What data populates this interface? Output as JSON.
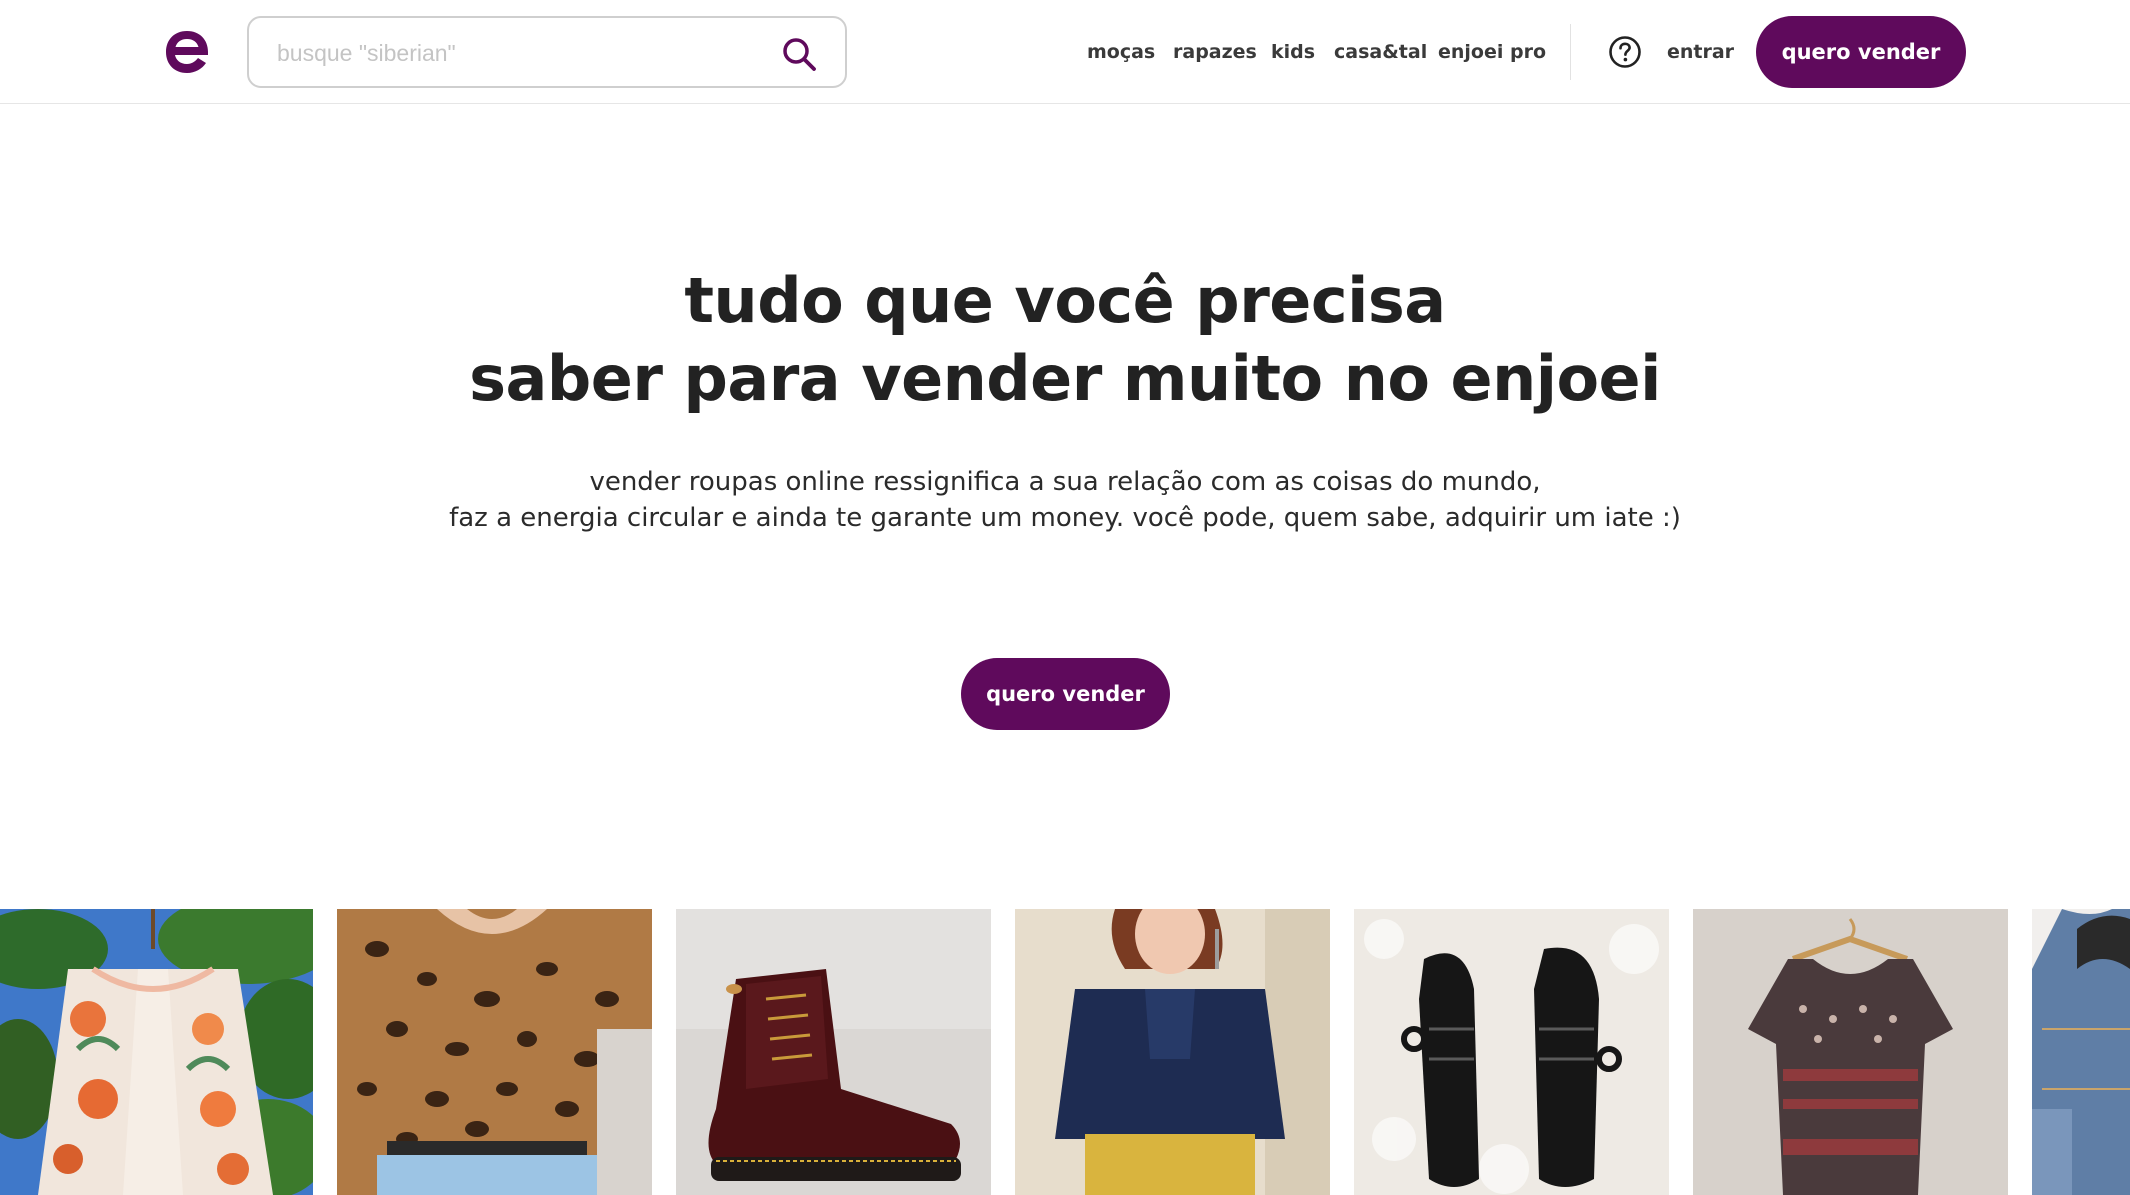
{
  "header": {
    "logo_icon": "enjoei-e-logo",
    "search": {
      "placeholder": "busque \"siberian\"",
      "value": "",
      "icon": "search-icon"
    },
    "nav": [
      {
        "label": "moças"
      },
      {
        "label": "rapazes"
      },
      {
        "label": "kids"
      },
      {
        "label": "casa&tal"
      },
      {
        "label": "enjoei pro"
      }
    ],
    "help_icon": "question-circle-icon",
    "login_label": "entrar",
    "sell_label": "quero vender"
  },
  "hero": {
    "title_line1": "tudo que você precisa",
    "title_line2": "saber para vender muito no enjoei",
    "subtitle_line1": "vender roupas online ressignifica a sua relação com as coisas do mundo,",
    "subtitle_line2": "faz a energia circular e ainda te garante um money. você pode, quem sabe, adquirir um iate :)",
    "cta_label": "quero vender"
  },
  "products": [
    {
      "name": "floral-kimono-on-tree"
    },
    {
      "name": "leopard-print-blouse"
    },
    {
      "name": "burgundy-leather-boot"
    },
    {
      "name": "navy-blouse-yellow-skirt"
    },
    {
      "name": "black-jelly-sandals"
    },
    {
      "name": "printed-dress-on-hanger"
    },
    {
      "name": "denim-jacket"
    }
  ],
  "colors": {
    "brand": "#5f0a5c",
    "text": "#222222",
    "border": "#cfcfcf"
  }
}
